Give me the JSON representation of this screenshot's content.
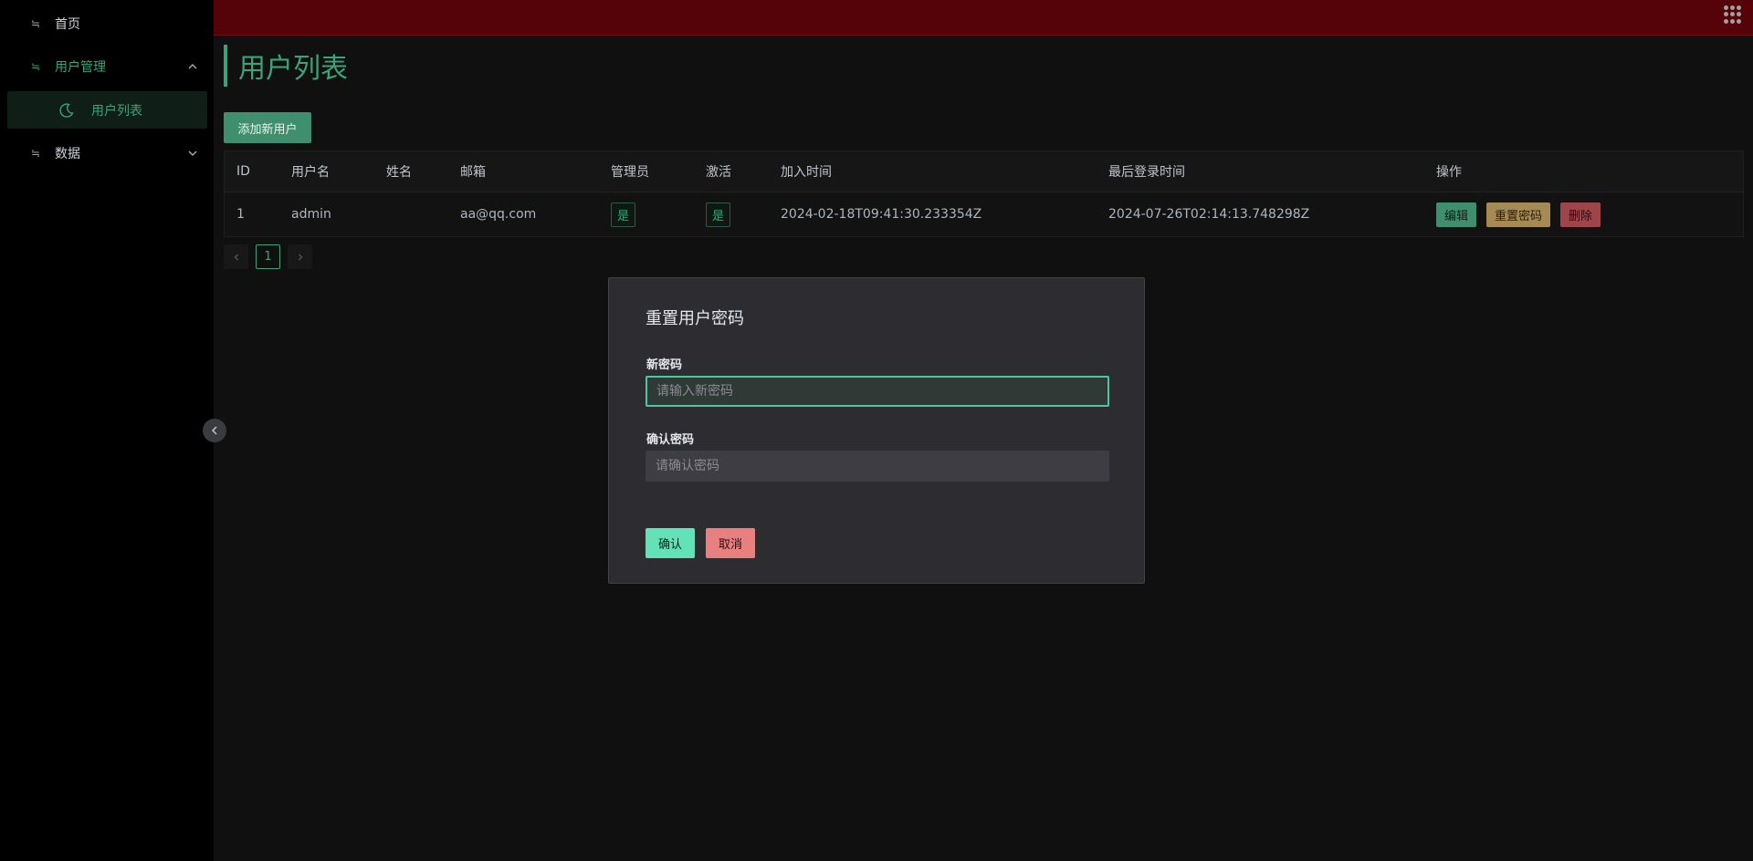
{
  "sidebar": {
    "items": [
      {
        "icon": "≒",
        "label": "首页"
      },
      {
        "icon": "≒",
        "label": "用户管理"
      },
      {
        "icon": "≒",
        "label": "数据"
      }
    ],
    "submenu": {
      "label": "用户列表"
    }
  },
  "page": {
    "title": "用户列表",
    "add_user_label": "添加新用户"
  },
  "table": {
    "columns": [
      "ID",
      "用户名",
      "姓名",
      "邮箱",
      "管理员",
      "激活",
      "加入时间",
      "最后登录时间",
      "操作"
    ],
    "rows": [
      {
        "id": "1",
        "username": "admin",
        "name": "",
        "email": "aa@qq.com",
        "admin": "是",
        "active": "是",
        "joined": "2024-02-18T09:41:30.233354Z",
        "last_login": "2024-07-26T02:14:13.748298Z",
        "actions": {
          "edit": "编辑",
          "reset": "重置密码",
          "delete": "删除"
        }
      }
    ]
  },
  "pagination": {
    "current": "1"
  },
  "modal": {
    "title": "重置用户密码",
    "new_password_label": "新密码",
    "new_password_placeholder": "请输入新密码",
    "confirm_password_label": "确认密码",
    "confirm_password_placeholder": "请确认密码",
    "confirm_label": "确认",
    "cancel_label": "取消"
  },
  "colors": {
    "accent": "#3ba37a",
    "header": "#550208",
    "confirm": "#63e2b7",
    "cancel": "#e88080"
  }
}
